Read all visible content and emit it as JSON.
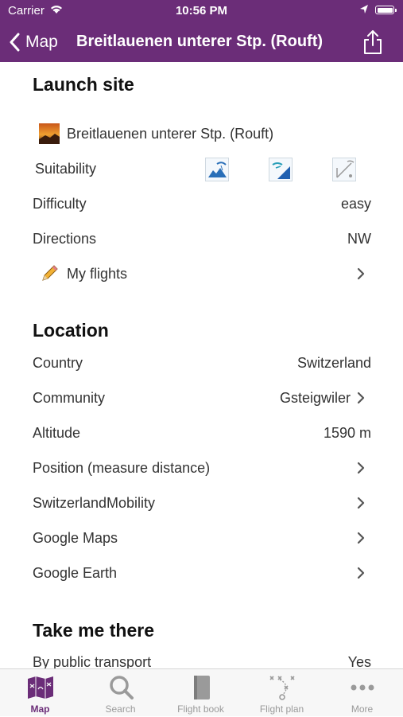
{
  "status": {
    "carrier": "Carrier",
    "time": "10:56 PM"
  },
  "nav": {
    "back_label": "Map",
    "title": "Breitlauenen unterer Stp. (Rouft)"
  },
  "launch": {
    "heading": "Launch site",
    "name": "Breitlauenen unterer Stp. (Rouft)",
    "suitability_label": "Suitability",
    "suitability_icons": [
      "paragliding-icon",
      "hanggliding-icon",
      "landing-icon"
    ],
    "difficulty_label": "Difficulty",
    "difficulty_value": "easy",
    "directions_label": "Directions",
    "directions_value": "NW",
    "myflights_label": "My flights"
  },
  "location": {
    "heading": "Location",
    "country_label": "Country",
    "country_value": "Switzerland",
    "community_label": "Community",
    "community_value": "Gsteigwiler",
    "altitude_label": "Altitude",
    "altitude_value": "1590 m",
    "position_label": "Position (measure distance)",
    "swissmobility_label": "SwitzerlandMobility",
    "googlemaps_label": "Google Maps",
    "googleearth_label": "Google Earth"
  },
  "takeme": {
    "heading": "Take me there",
    "transport_label": "By public transport",
    "transport_value": "Yes"
  },
  "tabs": [
    {
      "label": "Map",
      "icon": "map-icon",
      "active": true
    },
    {
      "label": "Search",
      "icon": "search-icon",
      "active": false
    },
    {
      "label": "Flight book",
      "icon": "book-icon",
      "active": false
    },
    {
      "label": "Flight plan",
      "icon": "flight-plan-icon",
      "active": false
    },
    {
      "label": "More",
      "icon": "more-icon",
      "active": false
    }
  ],
  "colors": {
    "accent": "#6b2d78",
    "chevron": "#555555",
    "tab_inactive": "#9a9a9a"
  }
}
